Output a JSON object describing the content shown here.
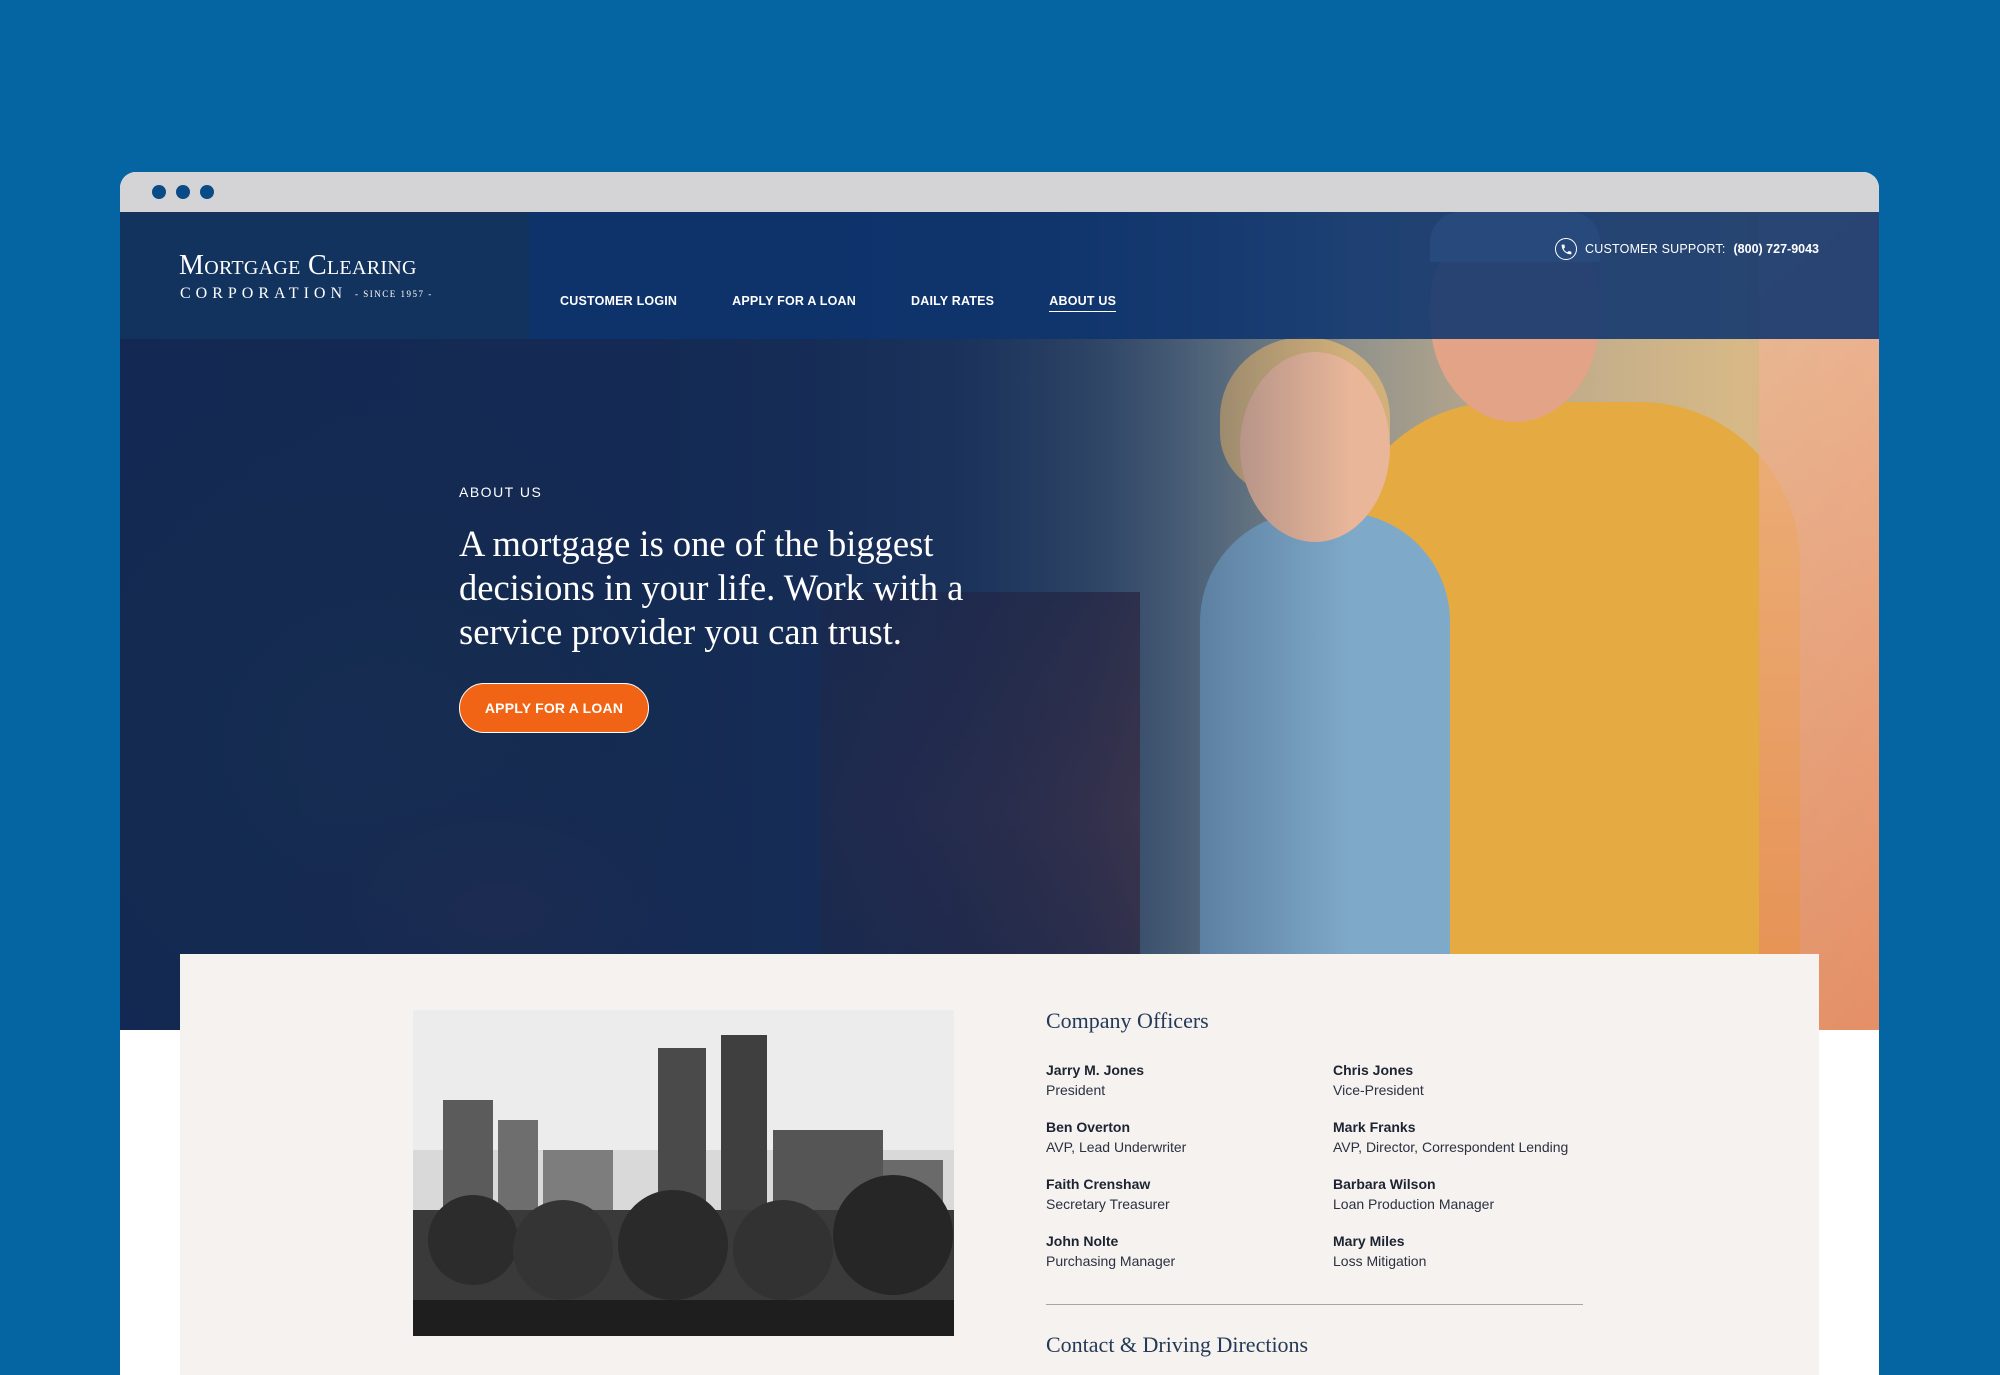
{
  "header": {
    "logo_title": "Mortgage Clearing",
    "logo_corp": "CORPORATION",
    "logo_since": "- SINCE 1957 -",
    "nav": [
      {
        "label": "CUSTOMER LOGIN"
      },
      {
        "label": "APPLY FOR A LOAN"
      },
      {
        "label": "DAILY RATES"
      },
      {
        "label": "ABOUT US"
      }
    ],
    "active_nav": "ABOUT US",
    "support_label": "CUSTOMER SUPPORT:",
    "support_phone": "(800) 727-9043"
  },
  "hero": {
    "eyebrow": "ABOUT US",
    "headline": "A mortgage is one of the biggest decisions in your life. Work with a service provider you can trust.",
    "cta_label": "APPLY FOR A LOAN"
  },
  "officers": {
    "title": "Company Officers",
    "list": [
      {
        "name": "Jarry M. Jones",
        "role": "President"
      },
      {
        "name": "Chris Jones",
        "role": "Vice-President"
      },
      {
        "name": "Ben Overton",
        "role": "AVP, Lead Underwriter"
      },
      {
        "name": "Mark Franks",
        "role": "AVP, Director, Correspondent Lending"
      },
      {
        "name": "Faith Crenshaw",
        "role": "Secretary Treasurer"
      },
      {
        "name": "Barbara Wilson",
        "role": "Loan Production Manager"
      },
      {
        "name": "John Nolte",
        "role": "Purchasing Manager"
      },
      {
        "name": "Mary Miles",
        "role": "Loss Mitigation"
      }
    ]
  },
  "contact": {
    "title": "Contact & Driving Directions"
  },
  "colors": {
    "page_background": "#0565a3",
    "header_navy": "#13335f",
    "cta_orange": "#f26415",
    "card_background": "#f5f2f0"
  },
  "icons": {
    "phone": "phone-icon"
  }
}
